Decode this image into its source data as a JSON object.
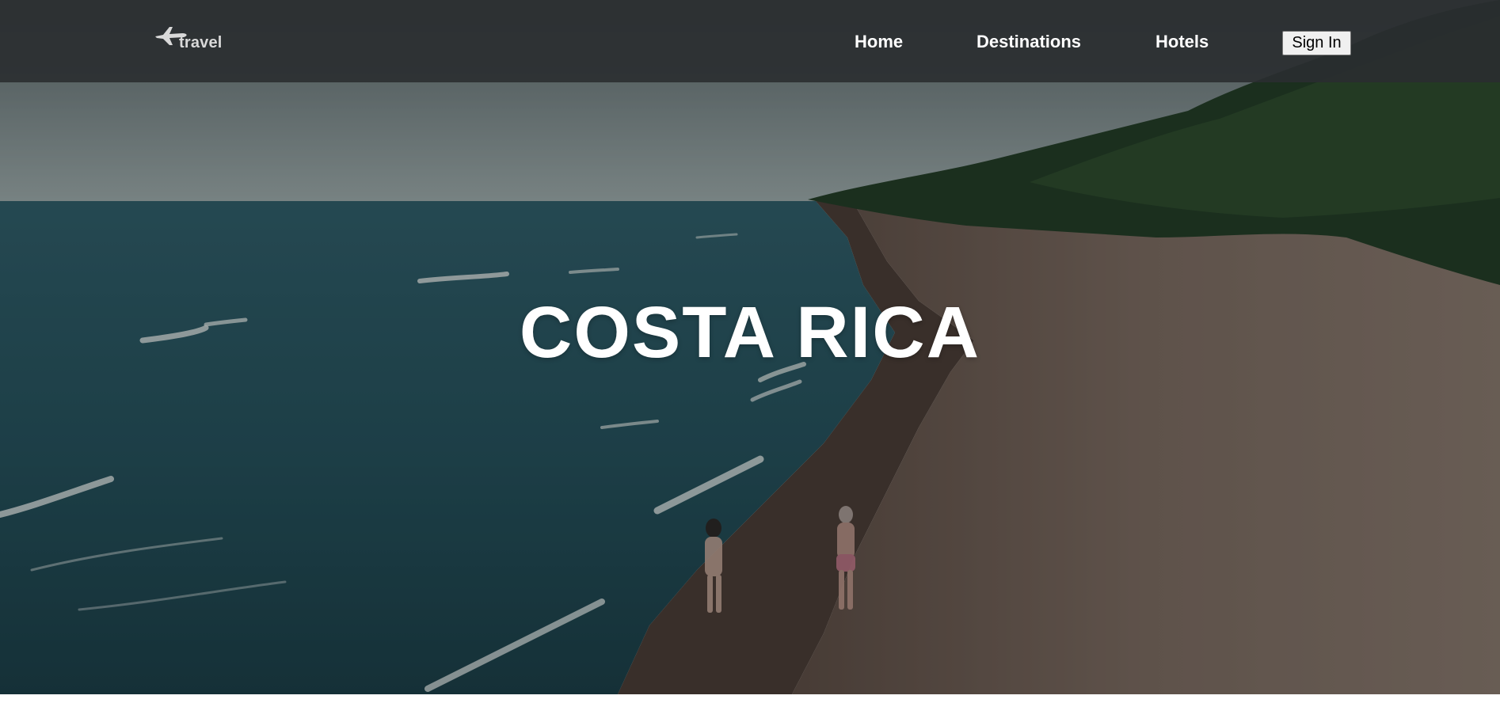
{
  "logo": {
    "text": "travel",
    "icon": "airplane-icon",
    "color": "#d9d9d9"
  },
  "nav": {
    "home": "Home",
    "destinations": "Destinations",
    "hotels": "Hotels",
    "sign_in": "Sign In"
  },
  "hero": {
    "title": "COSTA RICA",
    "background": "beach-aerial-photo"
  },
  "colors": {
    "navbar": "#2a2e30",
    "sea": "#1f4a57",
    "sand": "#7a6a5f",
    "sky": "#8a9a9c",
    "trees": "#1e3520"
  }
}
